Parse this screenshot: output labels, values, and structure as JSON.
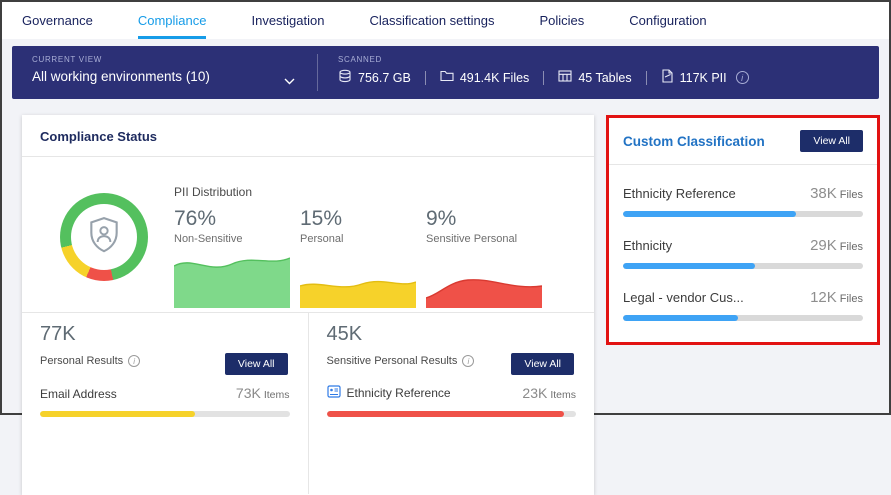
{
  "nav": {
    "items": [
      {
        "label": "Governance",
        "active": false
      },
      {
        "label": "Compliance",
        "active": true
      },
      {
        "label": "Investigation",
        "active": false
      },
      {
        "label": "Classification settings",
        "active": false
      },
      {
        "label": "Policies",
        "active": false
      },
      {
        "label": "Configuration",
        "active": false
      }
    ]
  },
  "header_bar": {
    "current_view_label": "CURRENT VIEW",
    "current_view_value": "All working environments  (10)",
    "scanned_label": "SCANNED",
    "stats": [
      {
        "icon": "database-icon",
        "value": "756.7 GB"
      },
      {
        "icon": "folder-icon",
        "value": "491.4K Files"
      },
      {
        "icon": "table-icon",
        "value": "45 Tables"
      },
      {
        "icon": "pii-file-icon",
        "value": "117K PII"
      }
    ]
  },
  "compliance_status": {
    "title": "Compliance Status",
    "pii_distribution_label": "PII Distribution",
    "distribution": [
      {
        "percent": "76%",
        "label": "Non-Sensitive",
        "color": "#7fd98a"
      },
      {
        "percent": "15%",
        "label": "Personal",
        "color": "#f6d22a"
      },
      {
        "percent": "9%",
        "label": "Sensitive Personal",
        "color": "#ef5148"
      }
    ],
    "personal": {
      "count": "77K",
      "label": "Personal Results",
      "view_all_label": "View All",
      "items": [
        {
          "name": "Email Address",
          "value": "73K",
          "unit": "Items",
          "fill": 62,
          "color": "#f6d22a"
        }
      ]
    },
    "sensitive": {
      "count": "45K",
      "label": "Sensitive Personal Results",
      "view_all_label": "View All",
      "items": [
        {
          "name": "Ethnicity Reference",
          "value": "23K",
          "unit": "Items",
          "fill": 95,
          "color": "#ef5148"
        }
      ]
    }
  },
  "custom_classification": {
    "title": "Custom Classification",
    "view_all_label": "View All",
    "items": [
      {
        "name": "Ethnicity Reference",
        "value": "38K",
        "unit": "Files",
        "fill": 72
      },
      {
        "name": "Ethnicity",
        "value": "29K",
        "unit": "Files",
        "fill": 55
      },
      {
        "name": "Legal - vendor Cus...",
        "value": "12K",
        "unit": "Files",
        "fill": 48
      }
    ]
  },
  "colors": {
    "accent_blue": "#169ce8",
    "navy_bar": "#2c3076",
    "button_navy": "#1d2d69",
    "title_blue": "#2273c4",
    "green": "#54c05e",
    "yellow": "#f6d22a",
    "red": "#ef5148",
    "bar_blue": "#3ea3f5",
    "annotation_red": "#e21212"
  }
}
